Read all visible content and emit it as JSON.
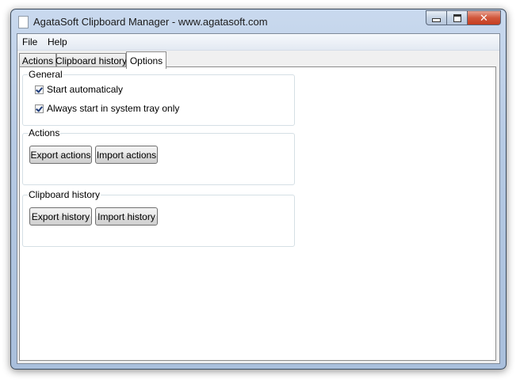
{
  "window": {
    "title": "AgataSoft Clipboard Manager - www.agatasoft.com",
    "close_glyph": "✕"
  },
  "menu": {
    "items": [
      "File",
      "Help"
    ]
  },
  "tabs": [
    {
      "label": "Actions",
      "active": false
    },
    {
      "label": "Clipboard history",
      "active": false
    },
    {
      "label": "Options",
      "active": true
    }
  ],
  "options": {
    "general": {
      "title": "General",
      "checkboxes": [
        {
          "label": "Start automaticaly",
          "checked": true
        },
        {
          "label": "Always start in system tray only",
          "checked": true
        }
      ]
    },
    "actions": {
      "title": "Actions",
      "export_label": "Export actions",
      "import_label": "Import actions"
    },
    "clipboard_history": {
      "title": "Clipboard history",
      "export_label": "Export history",
      "import_label": "Import history"
    }
  }
}
